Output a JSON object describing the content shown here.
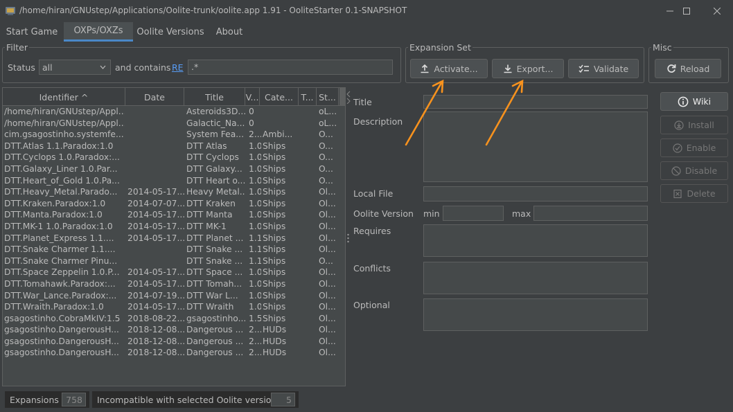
{
  "window": {
    "title": "/home/hiran/GNUstep/Applications/Oolite-trunk/oolite.app 1.91 - OoliteStarter 0.1-SNAPSHOT",
    "minimize": "—",
    "maximize": "☐",
    "close": "✕"
  },
  "tabs": [
    "Start Game",
    "OXPs/OXZs",
    "Oolite Versions",
    "About"
  ],
  "filter": {
    "group_label": "Filter",
    "status_label": "Status",
    "status_value": "all",
    "contains_label": "and contains",
    "re_link": "RE",
    "regex_value": ".*"
  },
  "expansion_set": {
    "group_label": "Expansion Set",
    "activate": "Activate...",
    "export": "Export...",
    "validate": "Validate"
  },
  "misc": {
    "group_label": "Misc",
    "reload": "Reload"
  },
  "table": {
    "columns": [
      "Identifier ^",
      "Date",
      "Title",
      "V...",
      "Cate...",
      "T...",
      "St..."
    ],
    "rows": [
      [
        "/home/hiran/GNUstep/Appl...",
        "",
        "Asteroids3D...",
        "0",
        "",
        "",
        "oL..."
      ],
      [
        "/home/hiran/GNUstep/Appl...",
        "",
        "Galactic_Na...",
        "0",
        "",
        "",
        "oL..."
      ],
      [
        "cim.gsagostinho.systemfe...",
        "",
        "System Fea...",
        "2...",
        "Ambi...",
        "",
        "O..."
      ],
      [
        "DTT.Atlas 1.1.Paradox:1.0",
        "",
        "DTT Atlas",
        "1.0",
        "Ships",
        "",
        "O..."
      ],
      [
        "DTT.Cyclops 1.0.Paradox:...",
        "",
        "DTT Cyclops",
        "1.0",
        "Ships",
        "",
        "O..."
      ],
      [
        "DTT.Galaxy_Liner 1.0.Par...",
        "",
        "DTT Galaxy...",
        "1.0",
        "Ships",
        "",
        "O..."
      ],
      [
        "DTT.Heart_of_Gold 1.0.Pa...",
        "",
        "DTT Heart o...",
        "1.0",
        "Ships",
        "",
        "O..."
      ],
      [
        "DTT.Heavy_Metal.Parado...",
        "2014-05-17...",
        "Heavy Metal...",
        "1.0",
        "Ships",
        "",
        "Ol..."
      ],
      [
        "DTT.Kraken.Paradox:1.0",
        "2014-07-07...",
        "DTT Kraken",
        "1.0",
        "Ships",
        "",
        "Ol..."
      ],
      [
        "DTT.Manta.Paradox:1.0",
        "2014-05-17...",
        "DTT Manta",
        "1.0",
        "Ships",
        "",
        "Ol..."
      ],
      [
        "DTT.MK-1 1.0.Paradox:1.0",
        "2014-05-17...",
        "DTT MK-1",
        "1.0",
        "Ships",
        "",
        "Ol..."
      ],
      [
        "DTT.Planet_Express 1.1....",
        "2014-05-17...",
        "DTT Planet ...",
        "1.1",
        "Ships",
        "",
        "Ol..."
      ],
      [
        "DTT.Snake Charmer 1.1....",
        "",
        "DTT Snake ...",
        "1.1",
        "Ships",
        "",
        "Ol..."
      ],
      [
        "DTT.Snake Charmer Pinu...",
        "",
        "DTT Snake ...",
        "1.1",
        "Ships",
        "",
        "O..."
      ],
      [
        "DTT.Space Zeppelin 1.0.P...",
        "2014-05-17...",
        "DTT Space ...",
        "1.0",
        "Ships",
        "",
        "Ol..."
      ],
      [
        "DTT.Tomahawk.Paradox:...",
        "2014-05-17...",
        "DTT Tomah...",
        "1.0",
        "Ships",
        "",
        "Ol..."
      ],
      [
        "DTT.War_Lance.Paradox:...",
        "2014-07-19...",
        "DTT War L...",
        "1.0",
        "Ships",
        "",
        "Ol..."
      ],
      [
        "DTT.Wraith.Paradox:1.0",
        "2014-05-17...",
        "DTT Wraith",
        "1.0",
        "Ships",
        "",
        "Ol..."
      ],
      [
        "gsagostinho.CobraMkIV:1.5",
        "2018-08-22...",
        "gsagostinho...",
        "1.5",
        "Ships",
        "",
        "Ol..."
      ],
      [
        "gsagostinho.DangerousH...",
        "2018-12-08...",
        "Dangerous ...",
        "2...",
        "HUDs",
        "",
        "Ol..."
      ],
      [
        "gsagostinho.DangerousH...",
        "2018-12-08...",
        "Dangerous ...",
        "2...",
        "HUDs",
        "",
        "Ol..."
      ],
      [
        "gsagostinho.DangerousH...",
        "2018-12-08...",
        "Dangerous ...",
        "2...",
        "HUDs",
        "",
        "Ol..."
      ]
    ]
  },
  "details": {
    "title_label": "Title",
    "description_label": "Description",
    "local_file_label": "Local File",
    "oolite_version_label": "Oolite Version",
    "min_label": "min",
    "max_label": "max",
    "requires_label": "Requires",
    "conflicts_label": "Conflicts",
    "optional_label": "Optional"
  },
  "actions": {
    "wiki": "Wiki",
    "install": "Install",
    "enable": "Enable",
    "disable": "Disable",
    "delete": "Delete"
  },
  "status": {
    "expansions_label": "Expansions",
    "expansions_count": "758",
    "incompatible_label": "Incompatible with selected Oolite version",
    "incompatible_count": "5"
  },
  "colors": {
    "background": "#3c3f41",
    "accent": "#4a88c7",
    "annotation_arrow": "#f7921e"
  }
}
